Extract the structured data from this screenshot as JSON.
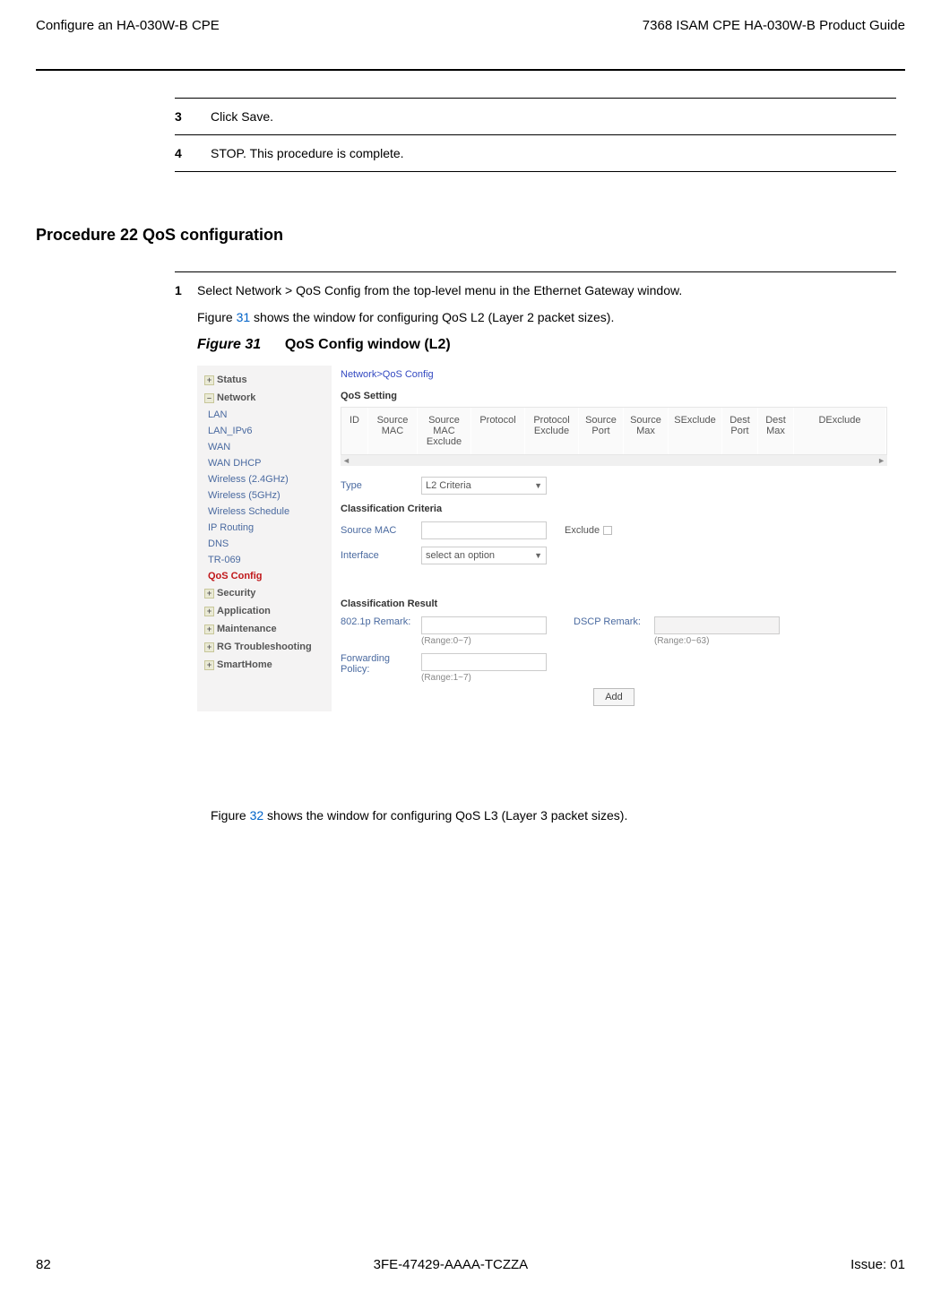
{
  "header": {
    "left": "Configure an HA-030W-B CPE",
    "right": "7368 ISAM CPE HA-030W-B Product Guide"
  },
  "steps_prev": {
    "s3": {
      "num": "3",
      "text": "Click Save."
    },
    "s4": {
      "num": "4",
      "text": "STOP. This procedure is complete."
    }
  },
  "procedure": {
    "title": "Procedure 22     QoS configuration"
  },
  "step1": {
    "num": "1",
    "line1a": "Select Network > QoS Config from the top-level menu in the Ethernet Gateway window.",
    "line2a": "Figure ",
    "line2ref": "31",
    "line2b": " shows the window for configuring QoS L2 (Layer 2 packet sizes).",
    "fig_title_a": "Figure 31",
    "fig_title_b": "QoS Config window (L2)"
  },
  "ui": {
    "breadcrumb": "Network>QoS Config",
    "sidebar": {
      "sections": [
        "Status",
        "Network",
        "Security",
        "Application",
        "Maintenance",
        "RG Troubleshooting",
        "SmartHome"
      ],
      "network_subs": [
        "LAN",
        "LAN_IPv6",
        "WAN",
        "WAN DHCP",
        "Wireless (2.4GHz)",
        "Wireless (5GHz)",
        "Wireless Schedule",
        "IP Routing",
        "DNS",
        "TR-069",
        "QoS Config"
      ]
    },
    "qos_setting": "QoS Setting",
    "table_headers": [
      "ID",
      "Source MAC",
      "Source MAC Exclude",
      "Protocol",
      "Protocol Exclude",
      "Source Port",
      "Source Max",
      "SExclude",
      "Dest Port",
      "Dest Max",
      "DExclude"
    ],
    "type": {
      "label": "Type",
      "value": "L2 Criteria"
    },
    "classification_criteria": "Classification Criteria",
    "src_mac": {
      "label": "Source MAC",
      "exclude_label": "Exclude"
    },
    "interface": {
      "label": "Interface",
      "value": "select an option"
    },
    "classification_result": "Classification Result",
    "p8021": {
      "label": "802.1p Remark:",
      "range": "(Range:0~7)"
    },
    "dscp": {
      "label": "DSCP Remark:",
      "range": "(Range:0~63)"
    },
    "fwd": {
      "label": "Forwarding Policy:",
      "range": "(Range:1~7)"
    },
    "add": "Add"
  },
  "fig32": {
    "a": "Figure ",
    "ref": "32",
    "b": " shows the window for configuring QoS L3 (Layer 3 packet sizes)."
  },
  "footer": {
    "page": "82",
    "code": "3FE-47429-AAAA-TCZZA",
    "issue": "Issue: 01"
  }
}
